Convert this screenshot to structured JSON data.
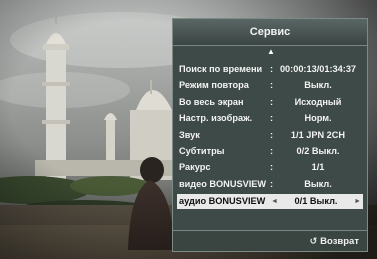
{
  "panel": {
    "title": "Сервис",
    "up_arrow": "▲",
    "items": [
      {
        "label": "Поиск по времени",
        "sep": ":",
        "value": "00:00:13/01:34:37"
      },
      {
        "label": "Режим повтора",
        "sep": ":",
        "value": "Выкл."
      },
      {
        "label": "Во весь экран",
        "sep": ":",
        "value": "Исходный"
      },
      {
        "label": "Настр. изображ.",
        "sep": ":",
        "value": "Норм."
      },
      {
        "label": "Звук",
        "sep": ":",
        "value": "1/1 JPN 2CH"
      },
      {
        "label": "Субтитры",
        "sep": ":",
        "value": "0/2 Выкл."
      },
      {
        "label": "Ракурс",
        "sep": ":",
        "value": "1/1"
      },
      {
        "label": "видео BONUSVIEW",
        "sep": ":",
        "value": "Выкл."
      },
      {
        "label": "аудио BONUSVIEW",
        "sep": "",
        "value": "0/1 Выкл.",
        "arrow_left": "◄",
        "arrow_right": "►"
      }
    ],
    "footer": {
      "return_icon": "↺",
      "return_label": "Возврат"
    }
  },
  "colors": {
    "panel_bg": "#3e4a47",
    "selected_bg": "#e9e9e9"
  }
}
